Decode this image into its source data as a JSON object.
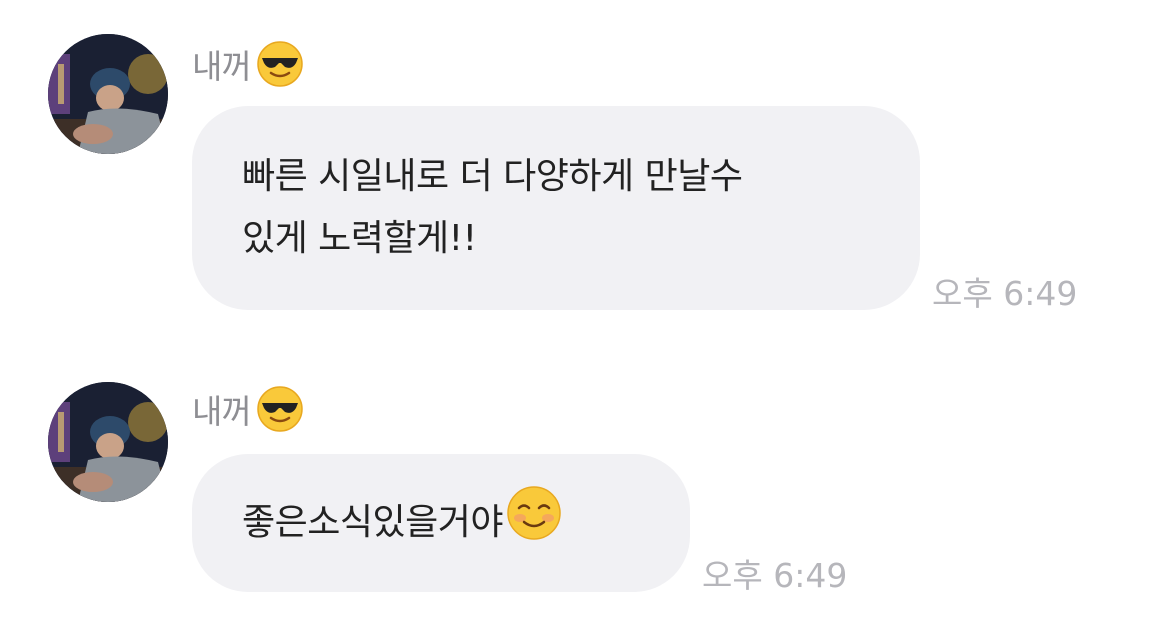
{
  "messages": [
    {
      "sender": "내꺼",
      "sender_emoji": "smiling-face-with-sunglasses-icon",
      "text_line1": "빠른 시일내로 더 다양하게 만날수",
      "text_line2": "있게 노력할게!!",
      "time": "오후 6:49"
    },
    {
      "sender": "내꺼",
      "sender_emoji": "smiling-face-with-sunglasses-icon",
      "text": "좋은소식있을거야",
      "text_emoji": "smiling-face-icon",
      "time": "오후 6:49"
    }
  ],
  "colors": {
    "bubble_bg": "#f1f1f4",
    "name_text": "#8e8e93",
    "time_text": "#b6b6bb",
    "message_text": "#222222"
  }
}
